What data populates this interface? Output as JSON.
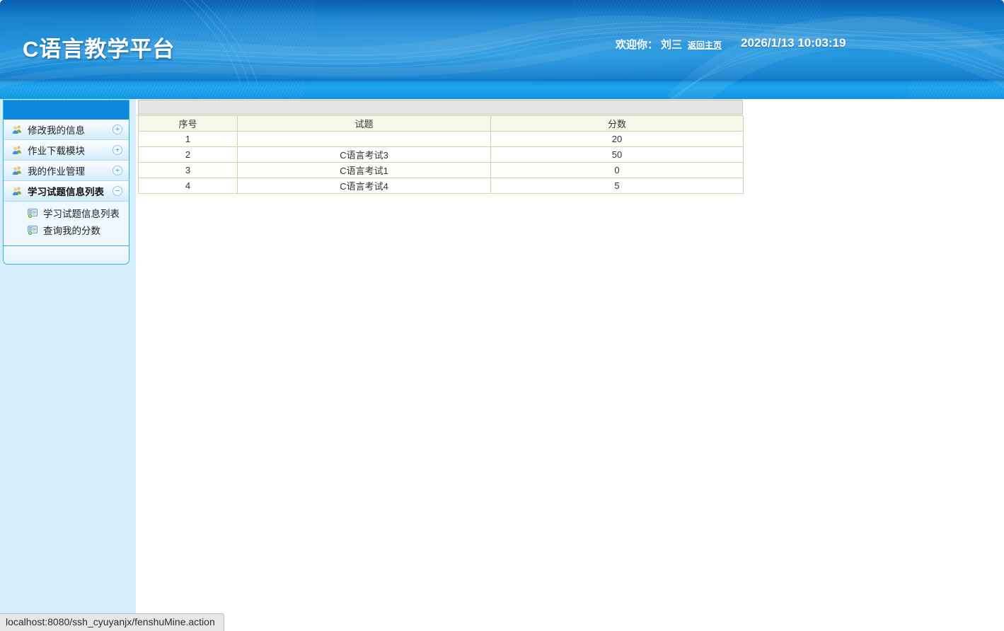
{
  "header": {
    "title": "C语言教学平台",
    "welcome_label": "欢迎你：",
    "username": "刘三",
    "home_link_label": "返回主页",
    "datetime": "2026/1/13 10:03:19"
  },
  "sidebar": {
    "items": [
      {
        "label": "修改我的信息",
        "icon": "users-icon",
        "toggle": "+"
      },
      {
        "label": "作业下载模块",
        "icon": "users-icon",
        "toggle": "+"
      },
      {
        "label": "我的作业管理",
        "icon": "users-icon",
        "toggle": "+"
      },
      {
        "label": "学习试题信息列表",
        "icon": "users-icon",
        "toggle": "−"
      }
    ],
    "subitems": [
      {
        "label": "学习试题信息列表",
        "icon": "id-card-add-icon"
      },
      {
        "label": "查询我的分数",
        "icon": "id-card-add-icon"
      }
    ]
  },
  "scores_table": {
    "columns": [
      "序号",
      "试题",
      "分数"
    ],
    "rows": [
      {
        "no": "1",
        "exam": "",
        "score": "20"
      },
      {
        "no": "2",
        "exam": "C语言考试3",
        "score": "50"
      },
      {
        "no": "3",
        "exam": "C语言考试1",
        "score": "0"
      },
      {
        "no": "4",
        "exam": "C语言考试4",
        "score": "5"
      }
    ]
  },
  "status_bar": {
    "url": "localhost:8080/ssh_cyuyanjx/fenshuMine.action"
  },
  "colors": {
    "header_blue": "#1f8fd9",
    "header_bottom_strip": "#139ae8",
    "sidebar_bg": "#d6eefb",
    "sidebar_border": "#29b2e8",
    "sidebar_header": "#0b87dc",
    "table_border": "#ccd6a8",
    "table_header_bg": "#f8f8ea",
    "caption_gray": "#e5e5e5"
  }
}
